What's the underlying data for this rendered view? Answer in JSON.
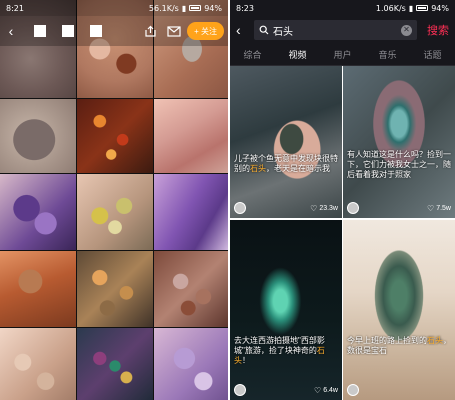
{
  "left": {
    "status": {
      "time": "8:21",
      "speed": "56.1K/s",
      "battery": "94%"
    },
    "topbar": {
      "follow_label": "+ 关注"
    },
    "tiles": [
      "t1",
      "t2",
      "t3",
      "t4",
      "t5",
      "t6",
      "t7",
      "t8",
      "t9",
      "t10",
      "t11",
      "t12",
      "t13",
      "t14",
      "t15"
    ]
  },
  "right": {
    "status": {
      "time": "8:23",
      "speed": "1.06K/s",
      "battery": "94%"
    },
    "search": {
      "query": "石头",
      "button_label": "搜索"
    },
    "tabs": [
      "综合",
      "视频",
      "用户",
      "音乐",
      "话题"
    ],
    "active_tab": "视频",
    "videos": [
      {
        "caption_pre": "儿子被个鱼无意中发现块很特别的",
        "caption_hl": "石头",
        "caption_post": "，老天是在暗示我",
        "likes": "23.3w"
      },
      {
        "caption_pre": "有人知道这是什么吗？捡到一下，它们力被我女士之一，随后看着我对于照家",
        "caption_hl": "",
        "caption_post": "",
        "likes": "7.5w"
      },
      {
        "caption_pre": "去大连西游拍摄地\"西部影城\"旅游，捡了块神奇的",
        "caption_hl": "石头",
        "caption_post": "！",
        "likes": "6.4w"
      },
      {
        "caption_pre": "今早上班的路上捡到的",
        "caption_hl": "石头",
        "caption_post": "，数很是宝石",
        "likes": ""
      }
    ]
  }
}
